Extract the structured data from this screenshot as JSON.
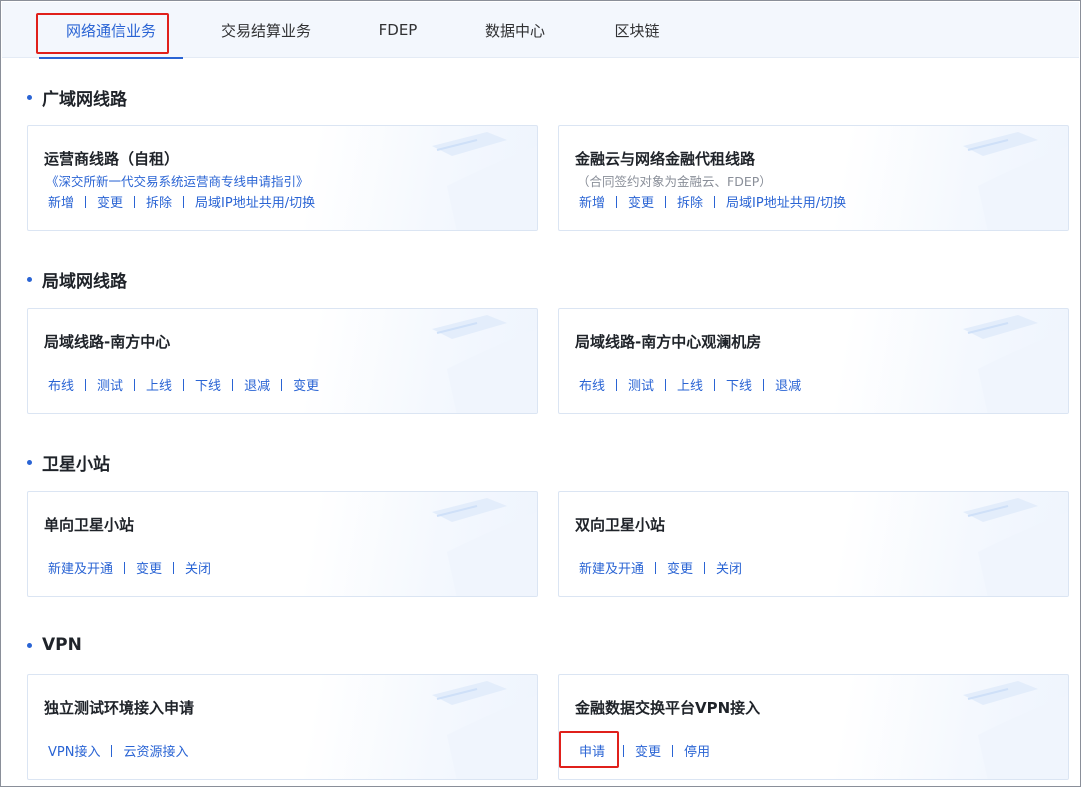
{
  "tabs": [
    {
      "label": "网络通信业务",
      "active": true
    },
    {
      "label": "交易结算业务",
      "active": false
    },
    {
      "label": "FDEP",
      "active": false
    },
    {
      "label": "数据中心",
      "active": false
    },
    {
      "label": "区块链",
      "active": false
    }
  ],
  "sections": [
    {
      "title": "广域网线路",
      "cards": [
        {
          "title": "运营商线路（自租）",
          "subtitle": "《深交所新一代交易系统运营商专线申请指引》",
          "subtitle_style": "link",
          "actions": [
            "新增",
            "变更",
            "拆除",
            "局域IP地址共用/切换"
          ]
        },
        {
          "title": "金融云与网络金融代租线路",
          "subtitle": "（合同签约对象为金融云、FDEP）",
          "subtitle_style": "muted",
          "actions": [
            "新增",
            "变更",
            "拆除",
            "局域IP地址共用/切换"
          ]
        }
      ]
    },
    {
      "title": "局域网线路",
      "cards": [
        {
          "title": "局域线路-南方中心",
          "actions": [
            "布线",
            "测试",
            "上线",
            "下线",
            "退减",
            "变更"
          ]
        },
        {
          "title": "局域线路-南方中心观澜机房",
          "actions": [
            "布线",
            "测试",
            "上线",
            "下线",
            "退减"
          ]
        }
      ]
    },
    {
      "title": "卫星小站",
      "cards": [
        {
          "title": "单向卫星小站",
          "actions": [
            "新建及开通",
            "变更",
            "关闭"
          ]
        },
        {
          "title": "双向卫星小站",
          "actions": [
            "新建及开通",
            "变更",
            "关闭"
          ]
        }
      ]
    },
    {
      "title": "VPN",
      "cards": [
        {
          "title": "独立测试环境接入申请",
          "actions": [
            "VPN接入",
            "云资源接入"
          ]
        },
        {
          "title": "金融数据交换平台VPN接入",
          "actions": [
            "申请",
            "变更",
            "停用"
          ]
        }
      ]
    }
  ],
  "colors": {
    "accent": "#2a64d4",
    "highlight": "#e0201b",
    "tabbar_bg": "#f3f7fd",
    "card_border": "#dbe5f3"
  }
}
